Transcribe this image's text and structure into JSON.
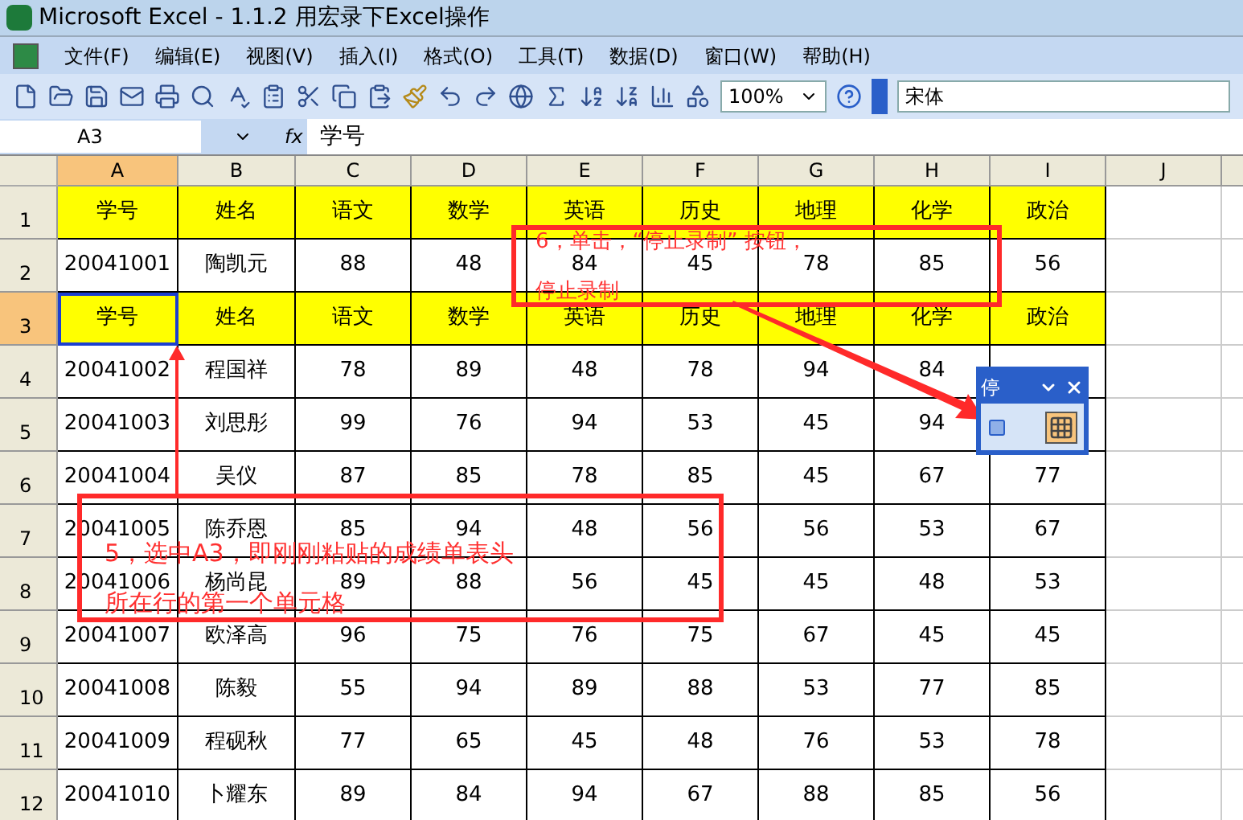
{
  "window": {
    "title": "Microsoft Excel - 1.1.2 用宏录下Excel操作"
  },
  "menu": [
    "文件(F)",
    "编辑(E)",
    "视图(V)",
    "插入(I)",
    "格式(O)",
    "工具(T)",
    "数据(D)",
    "窗口(W)",
    "帮助(H)"
  ],
  "toolbar": {
    "zoom": "100%",
    "font": "宋体"
  },
  "formula_bar": {
    "name_box": "A3",
    "fx": "fx",
    "value": "学号"
  },
  "columns": [
    {
      "label": "A",
      "selected": true
    },
    {
      "label": "B",
      "selected": false
    },
    {
      "label": "C",
      "selected": false
    },
    {
      "label": "D",
      "selected": false
    },
    {
      "label": "E",
      "selected": false
    },
    {
      "label": "F",
      "selected": false
    },
    {
      "label": "G",
      "selected": false
    },
    {
      "label": "H",
      "selected": false
    },
    {
      "label": "I",
      "selected": false
    },
    {
      "label": "J",
      "selected": false
    }
  ],
  "rows": [
    {
      "number": "1",
      "kind": "header",
      "selected": false,
      "cells": [
        "学号",
        "姓名",
        "语文",
        "数学",
        "英语",
        "历史",
        "地理",
        "化学",
        "政治"
      ]
    },
    {
      "number": "2",
      "kind": "data",
      "selected": false,
      "cells": [
        "20041001",
        "陶凯元",
        "88",
        "48",
        "84",
        "45",
        "78",
        "85",
        "56"
      ]
    },
    {
      "number": "3",
      "kind": "header",
      "selected": true,
      "cells": [
        "学号",
        "姓名",
        "语文",
        "数学",
        "英语",
        "历史",
        "地理",
        "化学",
        "政治"
      ]
    },
    {
      "number": "4",
      "kind": "data",
      "selected": false,
      "cells": [
        "20041002",
        "程国祥",
        "78",
        "89",
        "48",
        "78",
        "94",
        "84",
        null
      ]
    },
    {
      "number": "5",
      "kind": "data",
      "selected": false,
      "cells": [
        "20041003",
        "刘思彤",
        "99",
        "76",
        "94",
        "53",
        "45",
        "94",
        null
      ]
    },
    {
      "number": "6",
      "kind": "data",
      "selected": false,
      "cells": [
        "20041004",
        "吴仪",
        "87",
        "85",
        "78",
        "85",
        "45",
        "67",
        "77"
      ]
    },
    {
      "number": "7",
      "kind": "data",
      "selected": false,
      "cells": [
        "20041005",
        "陈乔恩",
        "85",
        "94",
        "48",
        "56",
        "56",
        "53",
        "67"
      ]
    },
    {
      "number": "8",
      "kind": "data",
      "selected": false,
      "cells": [
        "20041006",
        "杨尚昆",
        "89",
        "88",
        "56",
        "45",
        "45",
        "48",
        "53"
      ]
    },
    {
      "number": "9",
      "kind": "data",
      "selected": false,
      "cells": [
        "20041007",
        "欧泽高",
        "96",
        "75",
        "76",
        "75",
        "67",
        "45",
        "45"
      ]
    },
    {
      "number": "10",
      "kind": "data",
      "selected": false,
      "cells": [
        "20041008",
        "陈毅",
        "55",
        "94",
        "89",
        "88",
        "53",
        "77",
        "85"
      ]
    },
    {
      "number": "11",
      "kind": "data",
      "selected": false,
      "cells": [
        "20041009",
        "程砚秋",
        "77",
        "65",
        "45",
        "48",
        "76",
        "53",
        "78"
      ]
    },
    {
      "number": "12",
      "kind": "data",
      "selected": false,
      "cells": [
        "20041010",
        "卜耀东",
        "89",
        "84",
        "94",
        "67",
        "88",
        "85",
        "56"
      ]
    }
  ],
  "floating_toolbar": {
    "title": "停"
  },
  "annotations": [
    {
      "lines": [
        "6，单击，“停止录制” 按钮，",
        "停止录制"
      ]
    },
    {
      "lines": [
        "5，选中A3，即刚刚粘贴的成绩单表头",
        "所在行的第一个单元格"
      ]
    }
  ]
}
